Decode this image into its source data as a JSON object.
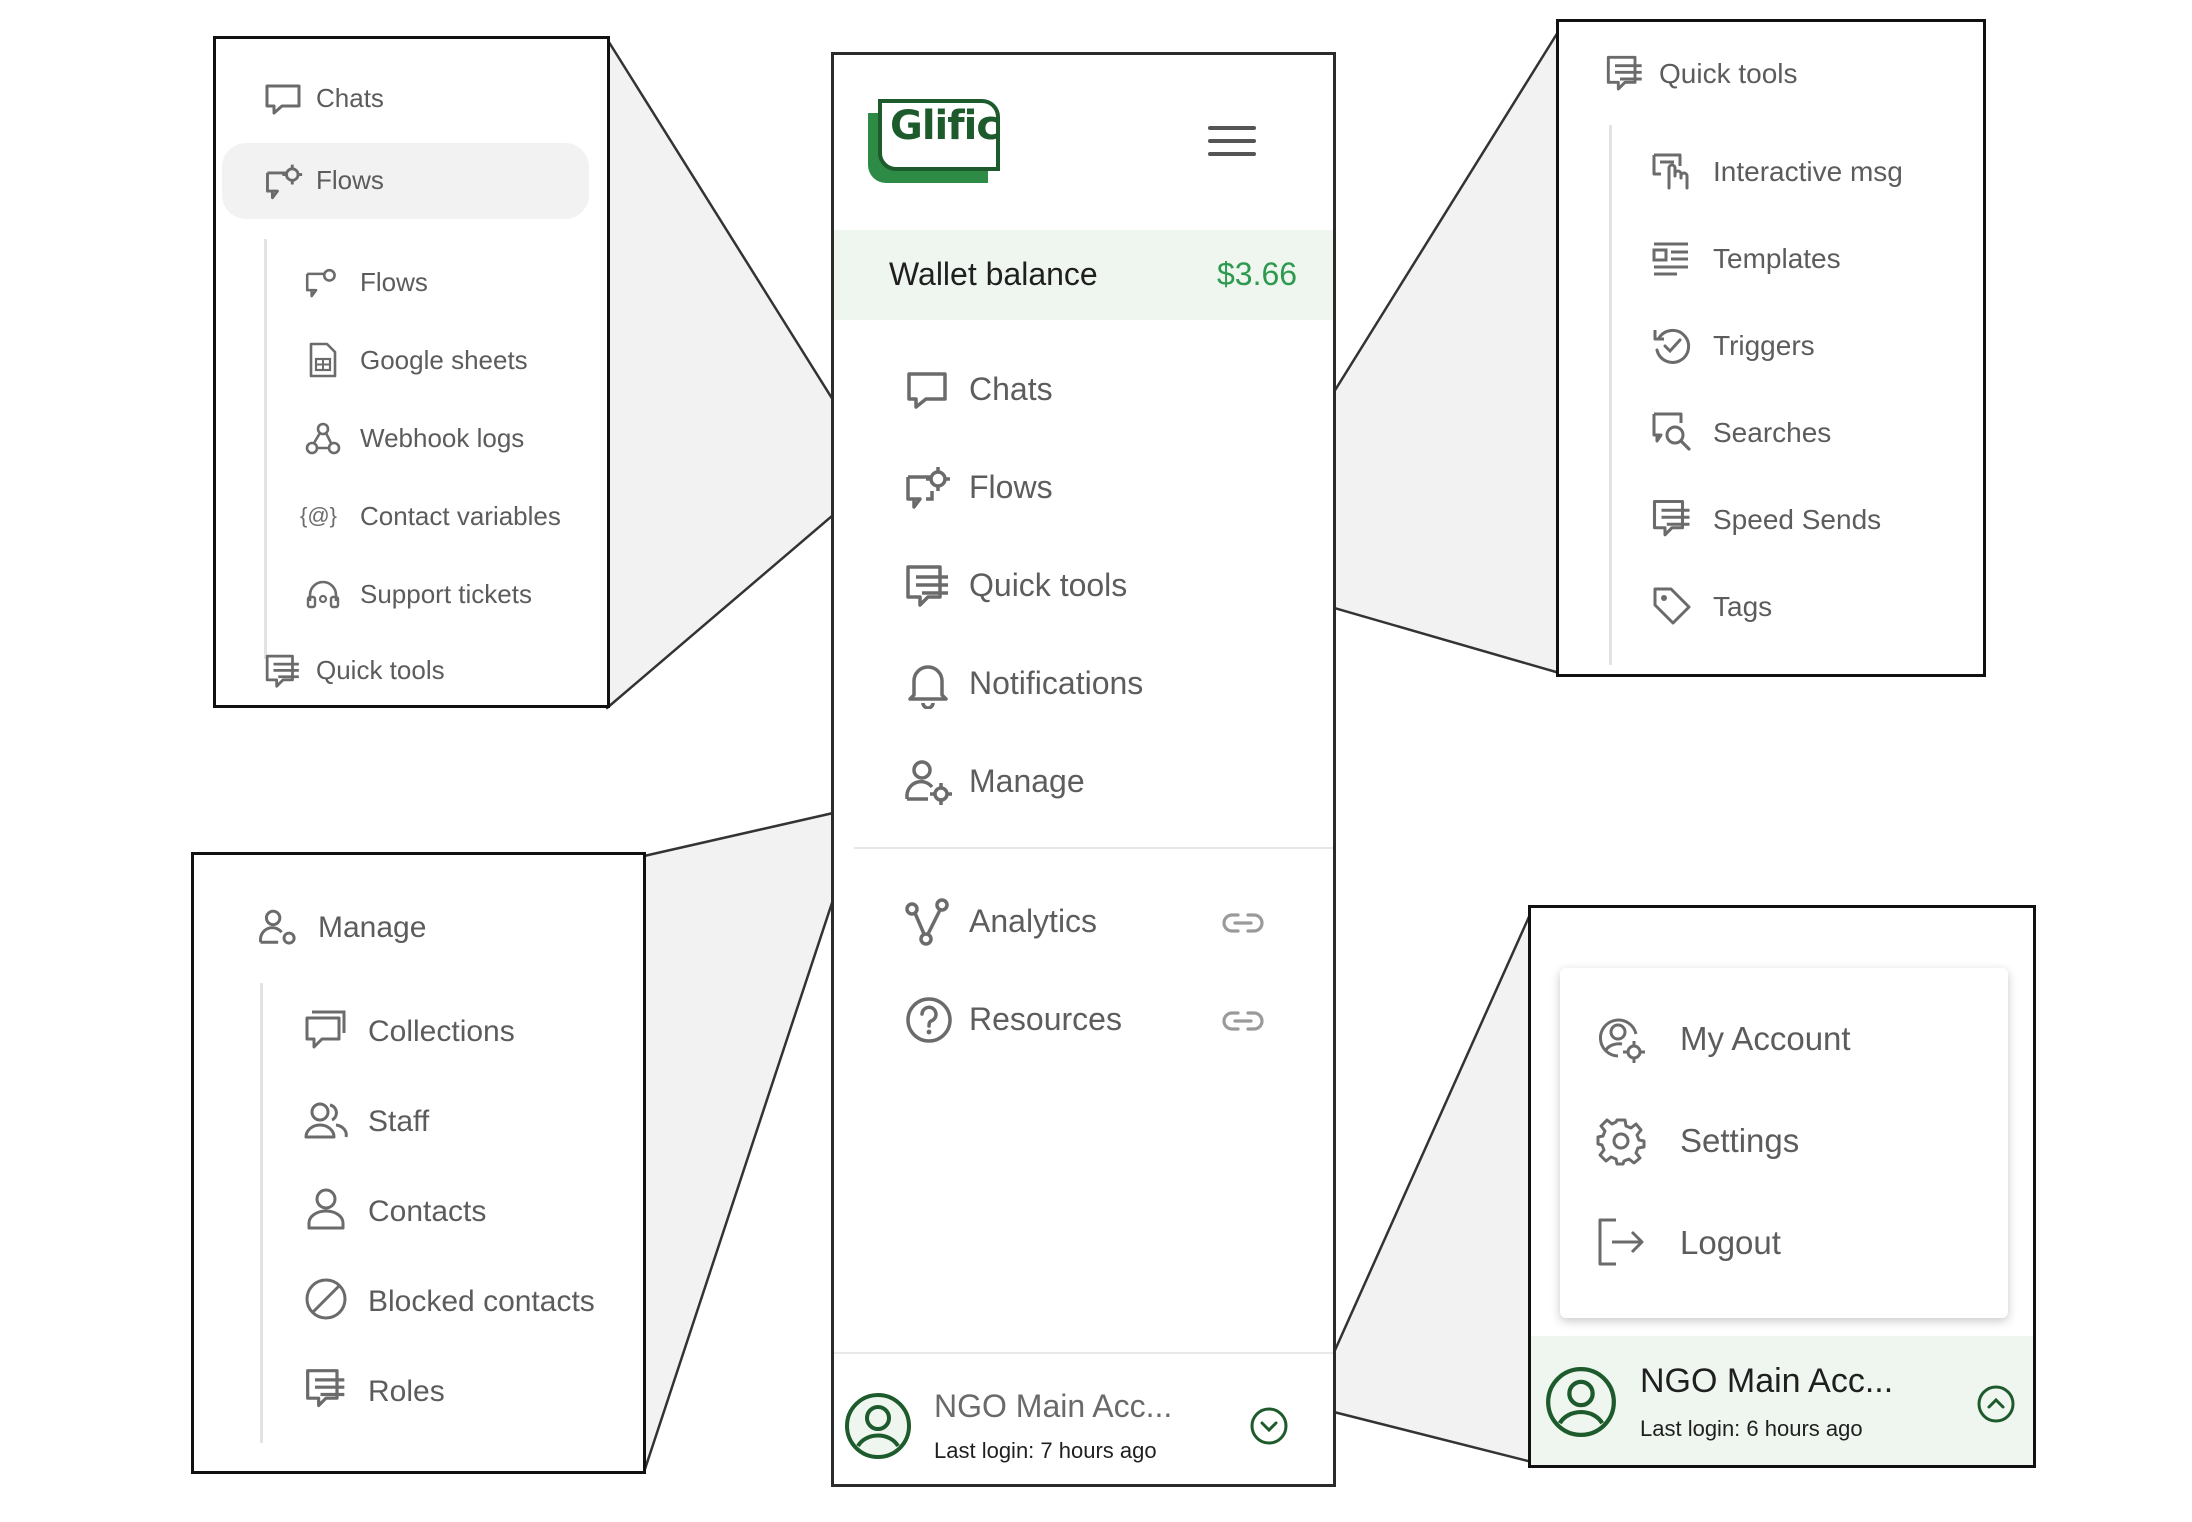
{
  "brand": {
    "logo_text": "Glific"
  },
  "wallet": {
    "label": "Wallet balance",
    "amount": "$3.66"
  },
  "nav": {
    "chats": "Chats",
    "flows": "Flows",
    "quick_tools": "Quick tools",
    "notifications": "Notifications",
    "manage": "Manage",
    "analytics": "Analytics",
    "resources": "Resources"
  },
  "footer": {
    "account_name": "NGO Main Acc...",
    "last_login": "Last login: 7 hours ago"
  },
  "zoom_flows": {
    "chats": "Chats",
    "flows": "Flows",
    "sub": [
      "Flows",
      "Google sheets",
      "Webhook logs",
      "Contact variables",
      "Support tickets"
    ],
    "contact_variables_glyph": "{@}",
    "quick_tools": "Quick tools"
  },
  "zoom_quick": {
    "title": "Quick tools",
    "sub": [
      "Interactive msg",
      "Templates",
      "Triggers",
      "Searches",
      "Speed Sends",
      "Tags"
    ]
  },
  "zoom_manage": {
    "title": "Manage",
    "sub": [
      "Collections",
      "Staff",
      "Contacts",
      "Blocked contacts",
      "Roles"
    ]
  },
  "zoom_account": {
    "menu": [
      "My Account",
      "Settings",
      "Logout"
    ],
    "account_name": "NGO Main Acc...",
    "last_login": "Last login: 6 hours ago"
  },
  "colors": {
    "brand_green": "#1d5a2c",
    "brand_green_light": "#2e8b46",
    "amount_green": "#2e9a4f",
    "wallet_bg": "#eef6ef",
    "icon_gray": "#6b6b6b"
  }
}
